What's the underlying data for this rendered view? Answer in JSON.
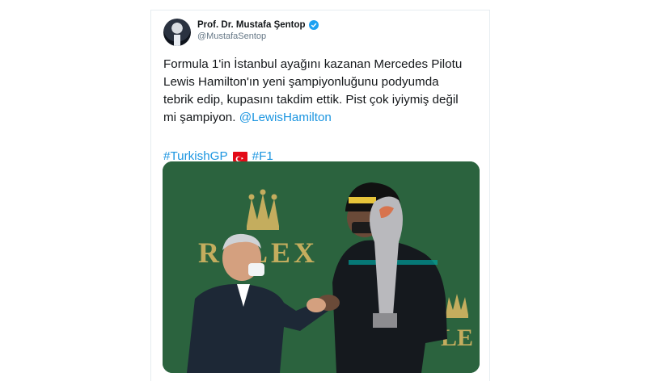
{
  "tweet": {
    "author_name": "Prof. Dr. Mustafa Şentop",
    "handle": "@MustafaSentop",
    "text_lines": [
      "Formula 1'in İstanbul ayağını kazanan Mercedes Pilotu",
      "Lewis Hamilton'ın yeni şampiyonluğunu podyumda",
      "tebrik edip, kupasını takdim ettik. Pist çok iyiymiş değil",
      "mi şampiyon."
    ],
    "mention": "@LewisHamilton",
    "hashtags": [
      "#TurkishGP",
      "#F1"
    ],
    "flag_icon": "turkey-flag-icon",
    "verified_icon": "verified-badge-icon"
  },
  "photo": {
    "banner_text": "ROLEX",
    "banner_text_partial": "LE",
    "colors": {
      "background_green": "#2f6b43",
      "rolex_gold": "#b8a055"
    }
  },
  "colors": {
    "link_blue": "#1b95e0",
    "text": "#14171a",
    "muted": "#657786"
  }
}
